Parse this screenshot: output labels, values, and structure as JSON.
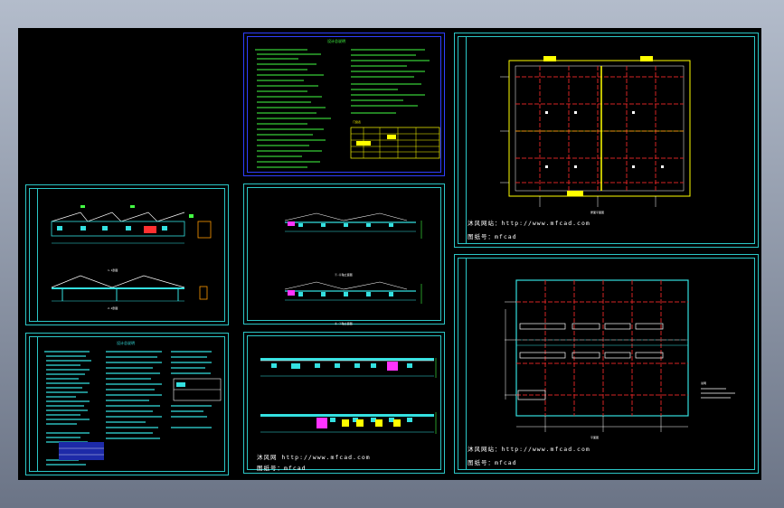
{
  "watermark": {
    "site_line": "沐风网 http://www.mfcad.com",
    "code_line": "图纸号：mfcad",
    "site_line_b": "沐风网站：http://www.mfcad.com",
    "code_line_b": "图纸号：mfcad"
  },
  "sheets": {
    "notes_title": "设计总说明",
    "table_title": "门窗表",
    "roof_label": "屋面平面图",
    "floor_label": "平面图",
    "legend_note": "说明",
    "elev_a": "①-⑥轴立面图",
    "elev_b": "⑥-①轴立面图",
    "section_a": "1-1剖面",
    "section_b": "2-2剖面"
  },
  "colors": {
    "background": "#000000",
    "frame": "#2bc6c6",
    "grid_red": "#d42323",
    "text_green": "#44ff44",
    "text_yellow": "#ffff00",
    "line_cyan": "#34e0e0",
    "blue_frame": "#2f3fff"
  }
}
